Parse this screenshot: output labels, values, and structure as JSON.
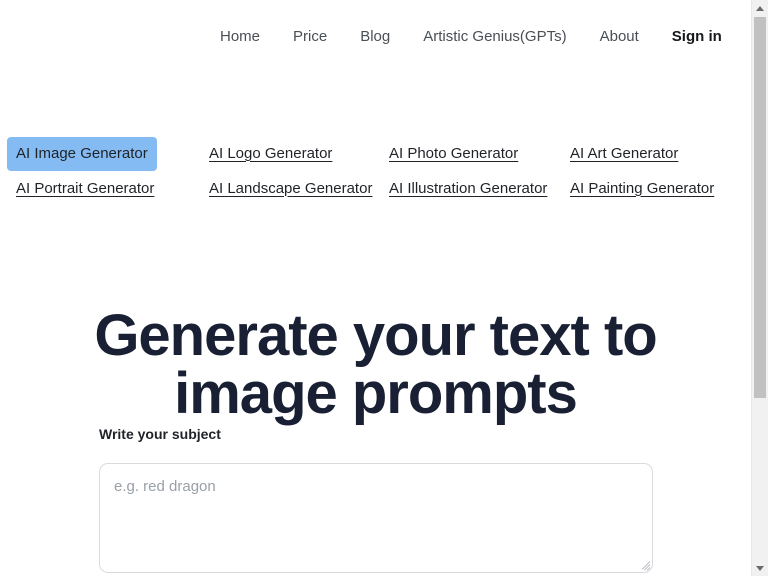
{
  "page": {
    "background_color": "#ffffff",
    "heading_color": "#1a2034",
    "accent_highlight_color": "#85bbf3"
  },
  "nav": {
    "items": [
      {
        "label": "Home",
        "accent": false
      },
      {
        "label": "Price",
        "accent": false
      },
      {
        "label": "Blog",
        "accent": false
      },
      {
        "label": "Artistic Genius(GPTs)",
        "accent": false
      },
      {
        "label": "About",
        "accent": false
      },
      {
        "label": "Sign in",
        "accent": true
      }
    ]
  },
  "categories": {
    "rows": [
      [
        {
          "label": "AI Image Generator",
          "active": true
        },
        {
          "label": "AI Logo Generator",
          "active": false
        },
        {
          "label": "AI Photo Generator",
          "active": false
        },
        {
          "label": "AI Art Generator",
          "active": false
        }
      ],
      [
        {
          "label": "AI Portrait Generator",
          "active": false
        },
        {
          "label": "AI Landscape Generator",
          "active": false
        },
        {
          "label": "AI Illustration Generator",
          "active": false
        },
        {
          "label": "AI Painting Generator",
          "active": false
        }
      ]
    ]
  },
  "hero": {
    "title_line_1": "Generate your text to",
    "title_line_2": "image prompts"
  },
  "form": {
    "subject_label": "Write your subject",
    "subject_placeholder": "e.g. red dragon",
    "subject_value": ""
  },
  "scrollbar": {
    "up_arrow": "scroll-up-arrow",
    "down_arrow": "scroll-down-arrow",
    "thumb": "scroll-thumb"
  }
}
